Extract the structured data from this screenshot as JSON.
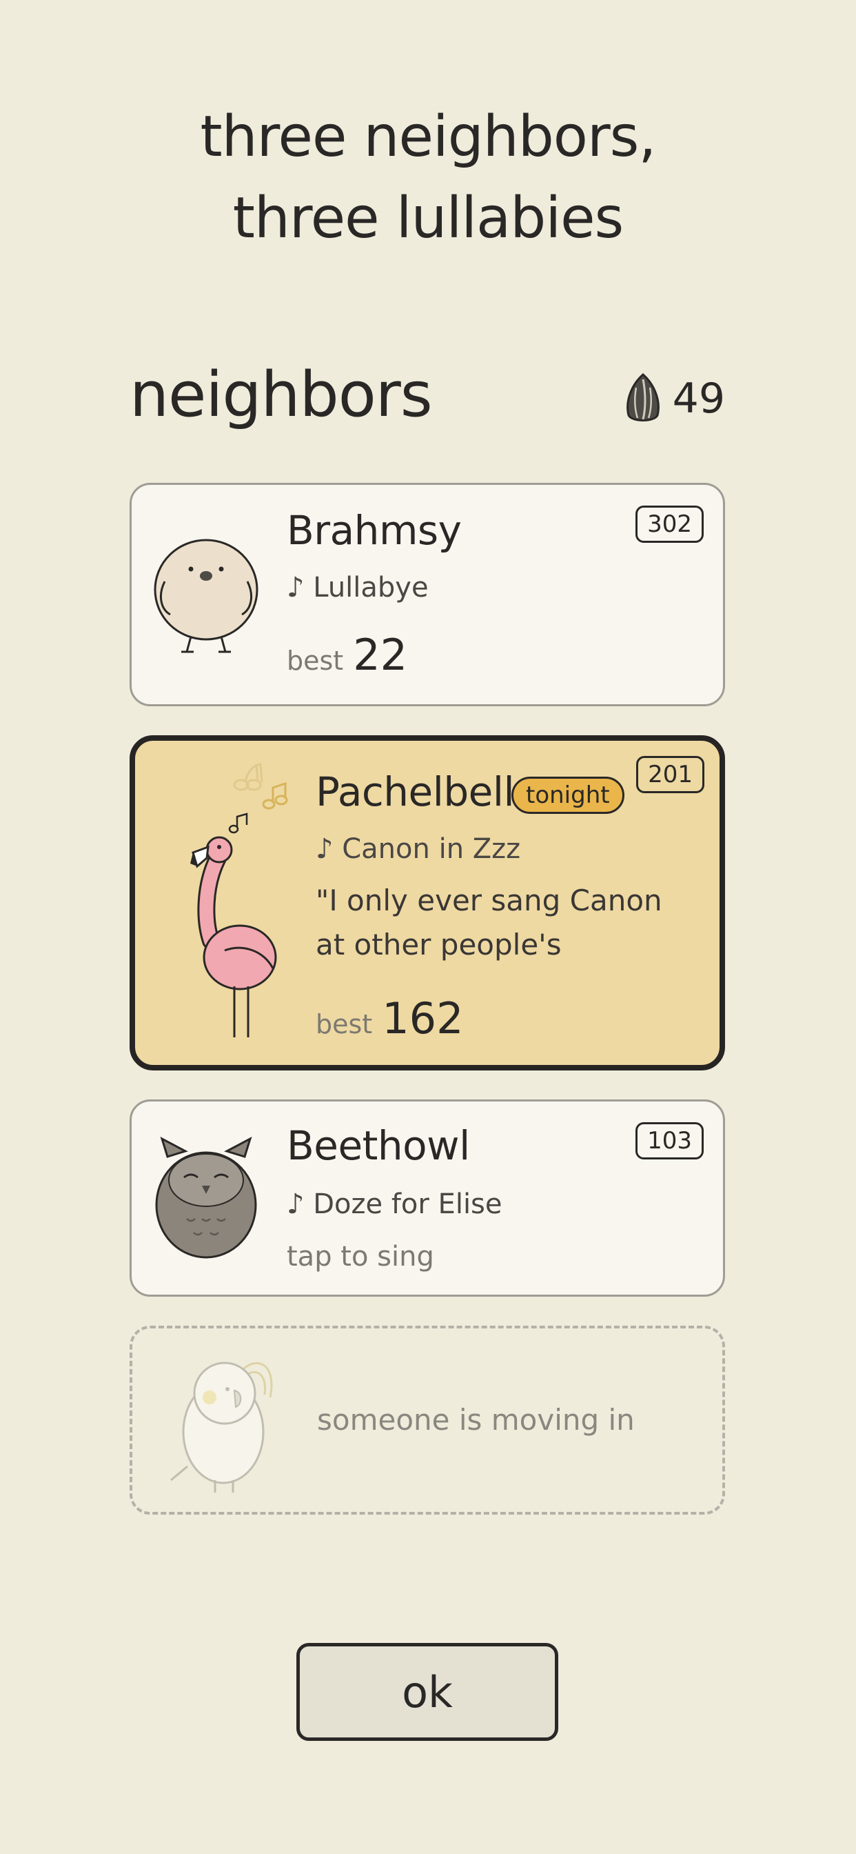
{
  "headline": {
    "line1": "three neighbors,",
    "line2": "three lullabies"
  },
  "section_title": "neighbors",
  "seeds": {
    "icon": "sunflower-seed-icon",
    "count": "49"
  },
  "neighbors": [
    {
      "name": "Brahmsy",
      "room": "302",
      "song": "♪ Lullabye",
      "best_label": "best",
      "best_value": "22",
      "avatar": "chick-icon"
    },
    {
      "name": "Pachelbelle",
      "room": "201",
      "badge": "tonight",
      "song": "♪ Canon in Zzz",
      "quote_line1": "\"I only ever sang Canon",
      "quote_line2": "at other people's",
      "best_label": "best",
      "best_value": "162",
      "avatar": "flamingo-icon",
      "highlight_color": "#eed9a3"
    },
    {
      "name": "Beethowl",
      "room": "103",
      "song": "♪ Doze for Elise",
      "hint": "tap to sing",
      "avatar": "owl-icon"
    }
  ],
  "empty_slot": {
    "text": "someone is moving in",
    "avatar": "cockatiel-icon"
  },
  "ok_button": {
    "label": "ok"
  },
  "colors": {
    "background": "#efecdc",
    "card": "#f8f6ef",
    "active_card": "#eed9a3",
    "badge": "#eab54a",
    "text": "#2a2826"
  }
}
